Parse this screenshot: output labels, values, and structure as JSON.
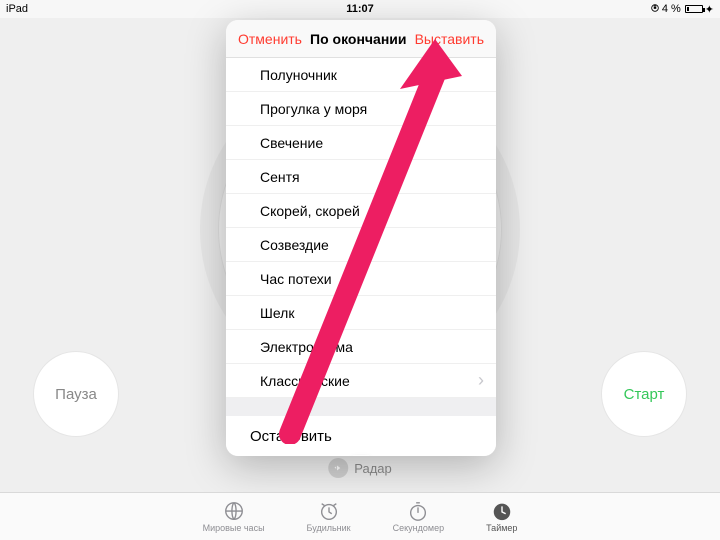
{
  "status": {
    "device": "iPad",
    "time": "11:07",
    "battery_pct": "4 %",
    "charging_glyph": "✦"
  },
  "sheet": {
    "cancel": "Отменить",
    "title": "По окончании",
    "done": "Выставить",
    "items": [
      "Полуночник",
      "Прогулка у моря",
      "Свечение",
      "Сентя",
      "Скорей, скорей",
      "Созвездие",
      "Час потехи",
      "Шелк",
      "Электросхема"
    ],
    "classic": "Классические",
    "stop": "Остановить"
  },
  "buttons": {
    "pause": "Пауза",
    "start": "Старт"
  },
  "sound_summary": "Радар",
  "tabs": {
    "world": "Мировые часы",
    "alarm": "Будильник",
    "stopwatch": "Секундомер",
    "timer": "Таймер"
  },
  "colors": {
    "accentRed": "#ff3b30",
    "startGreen": "#34c759",
    "annotation": "#ed1e62"
  }
}
